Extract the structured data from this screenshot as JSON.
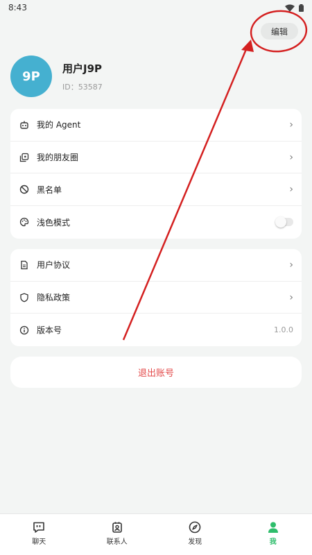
{
  "status_bar": {
    "time": "8:43"
  },
  "header": {
    "edit_label": "编辑"
  },
  "profile": {
    "avatar_text": "9P",
    "name": "用户J9P",
    "id_text": "ID：53587",
    "avatar_color": "#45b0d0"
  },
  "settings_group1": {
    "items": [
      {
        "label": "我的 Agent",
        "icon": "robot-icon"
      },
      {
        "label": "我的朋友圈",
        "icon": "gallery-icon"
      },
      {
        "label": "黑名单",
        "icon": "block-icon"
      },
      {
        "label": "浅色模式",
        "icon": "palette-icon",
        "toggle": false
      }
    ]
  },
  "settings_group2": {
    "items": [
      {
        "label": "用户协议",
        "icon": "document-icon"
      },
      {
        "label": "隐私政策",
        "icon": "shield-icon"
      },
      {
        "label": "版本号",
        "icon": "info-icon",
        "value": "1.0.0"
      }
    ]
  },
  "logout_label": "退出账号",
  "tabbar": {
    "tabs": [
      {
        "label": "聊天",
        "icon": "chat-icon"
      },
      {
        "label": "联系人",
        "icon": "contacts-icon"
      },
      {
        "label": "发现",
        "icon": "compass-icon"
      },
      {
        "label": "我",
        "icon": "person-icon",
        "active": true
      }
    ]
  },
  "colors": {
    "accent": "#2ebd6b",
    "danger": "#e34a4a",
    "annotation": "#d42020"
  }
}
